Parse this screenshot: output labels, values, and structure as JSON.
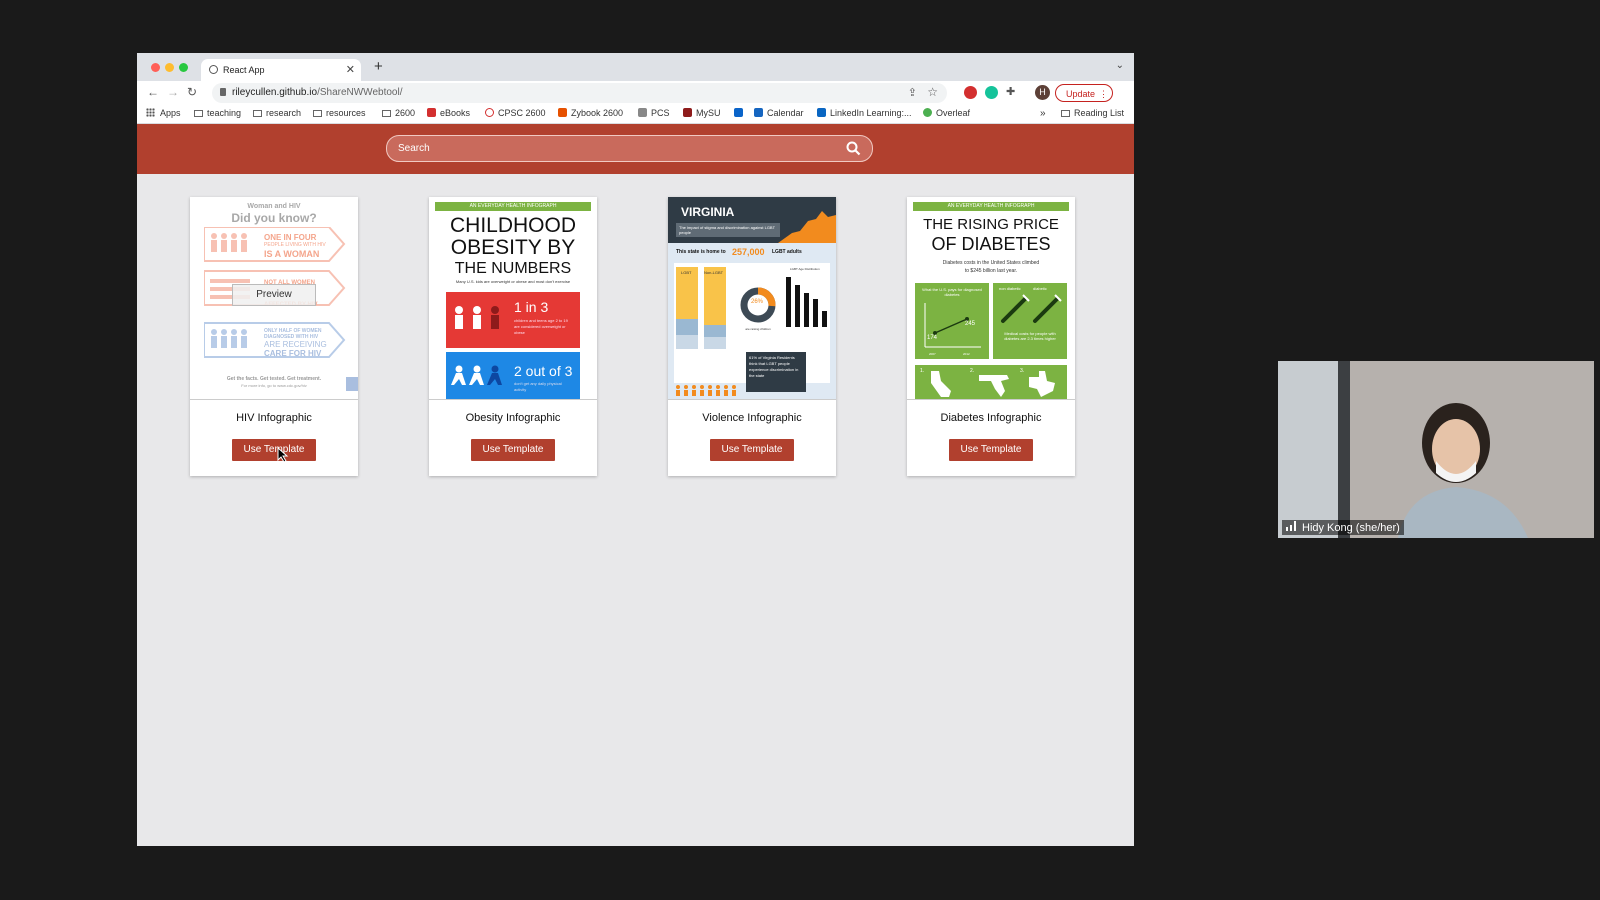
{
  "browser": {
    "tab_title": "React App",
    "url_host": "rileycullen.github.io",
    "url_path": "/ShareNWWebtool/",
    "update_label": "Update",
    "profile_initial": "H",
    "bookmarks": [
      "Apps",
      "teaching",
      "research",
      "resources",
      "2600",
      "eBooks",
      "CPSC 2600",
      "Zybook 2600",
      "PCS",
      "MySU",
      "Calendar",
      "LinkedIn Learning:...",
      "Overleaf"
    ],
    "overflow": "»",
    "reading_list": "Reading List"
  },
  "app": {
    "search_placeholder": "Search",
    "use_template_label": "Use Template",
    "preview_label": "Preview",
    "cards": [
      {
        "name": "HIV Infographic"
      },
      {
        "name": "Obesity Infographic"
      },
      {
        "name": "Violence Infographic"
      },
      {
        "name": "Diabetes Infographic"
      }
    ]
  },
  "thumbs": {
    "hiv": {
      "subtitle": "Woman and HIV",
      "title": "Did you know?",
      "b1a": "ONE IN FOUR",
      "b1b": "PEOPLE LIVING WITH HIV",
      "b1c": "IS A WOMAN",
      "b2a": "NOT ALL WOMEN",
      "b2c": "AFFECTED BY HIV",
      "b3a": "ONLY HALF OF WOMEN",
      "b3b": "DIAGNOSED WITH HIV",
      "b3c": "ARE RECEIVING",
      "b3d": "CARE FOR HIV",
      "foot1": "Get the facts. Get tested. Get treatment.",
      "foot2": "For more info, go to www.cdc.gov/hiv"
    },
    "obesity": {
      "ribbon": "AN EVERYDAY HEALTH INFOGRAPH",
      "t1": "CHILDHOOD",
      "t2": "OBESITY BY",
      "t3": "THE NUMBERS",
      "sub": "Many U.S. kids are overweight or obese and most don't exercise",
      "s1": "1 in 3",
      "s1d": "children and teens age 2 to 19 are considered overweight or obese",
      "s2": "2 out of 3",
      "s2d": "don't get any daily physical activity"
    },
    "violence": {
      "title": "VIRGINIA",
      "sub": "The impact of stigma and discrimination against LGBT people",
      "home": "This state is home to",
      "num": "257,000",
      "adults": "LGBT adults",
      "lgbt": "LGBT",
      "nonlgbt": "Non-LGBT",
      "age": "LGBT Age Distribution",
      "pct": "26%",
      "raising": "are raising children",
      "quote": "61% of Virginia Residents think that LGBT people experience discrimination in the state"
    },
    "diabetes": {
      "ribbon": "AN EVERYDAY HEALTH INFOGRAPH",
      "t1": "THE RISING PRICE",
      "t2": "OF DIABETES",
      "sub1": "Diabetes costs in the United States climbed",
      "sub2": "to $245 billion last year.",
      "p1": "What the U.S. pays for diagnosed diabetes",
      "v1": "174",
      "v2": "245",
      "y1": "2007",
      "y2": "2012",
      "nod": "non diabetic",
      "dia": "diabetic",
      "p2": "Medical costs for people with diabetes are 2.3 times higher",
      "r1": "1.",
      "r2": "2.",
      "r3": "3."
    }
  },
  "video": {
    "participant": "Hidy Kong (she/her)"
  }
}
